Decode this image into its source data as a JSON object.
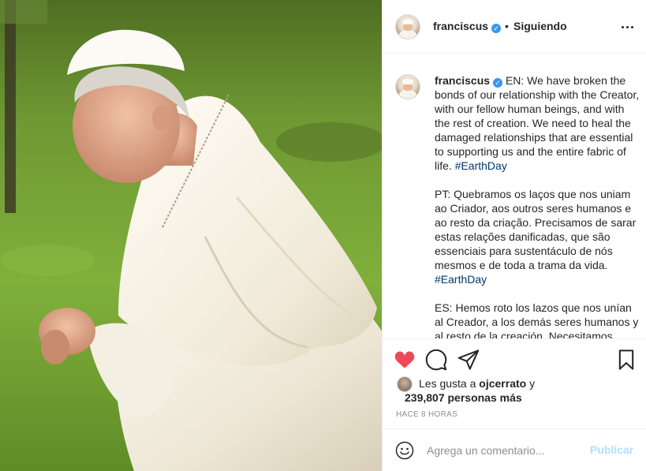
{
  "post": {
    "username": "franciscus",
    "verified_icon": "verified-badge-icon",
    "separator": "•",
    "follow_status": "Siguiendo",
    "more_icon": "more-options-icon"
  },
  "caption": {
    "username": "franciscus",
    "en_text": "EN: We have broken the bonds of our relationship with the Creator, with our fellow human beings, and with the rest of creation. We need to heal the damaged relationships that are essential to supporting us and the entire fabric of life.",
    "en_tag": "#EarthDay",
    "pt_text": "PT: Quebramos os laços que nos uniam ao Criador, aos outros seres humanos e ao resto da criação. Precisamos de sarar estas relações danificadas, que são essenciais para sustentáculo de nós mesmos e de toda a trama da vida.",
    "pt_tag": "#EarthDay",
    "es_text": "ES: Hemos roto los lazos que nos unían al Creador, a los demás seres humanos y al resto de la creación. Necesitamos"
  },
  "actions": {
    "like_icon": "heart-filled-icon",
    "comment_icon": "comment-icon",
    "share_icon": "share-icon",
    "save_icon": "bookmark-icon",
    "like_color": "#ed4956"
  },
  "likes": {
    "prefix": "Les gusta a",
    "user": "ojcerrato",
    "suffix": "y",
    "count_text": "239,807 personas más"
  },
  "timestamp": "HACE 8 HORAS",
  "comment_box": {
    "placeholder": "Agrega un comentario...",
    "publish_label": "Publicar",
    "emoji_icon": "emoji-icon"
  },
  "colors": {
    "link": "#00376b",
    "verified": "#3897f0",
    "publish_disabled": "#b2dffc",
    "secondary_text": "#8e8e8e"
  }
}
